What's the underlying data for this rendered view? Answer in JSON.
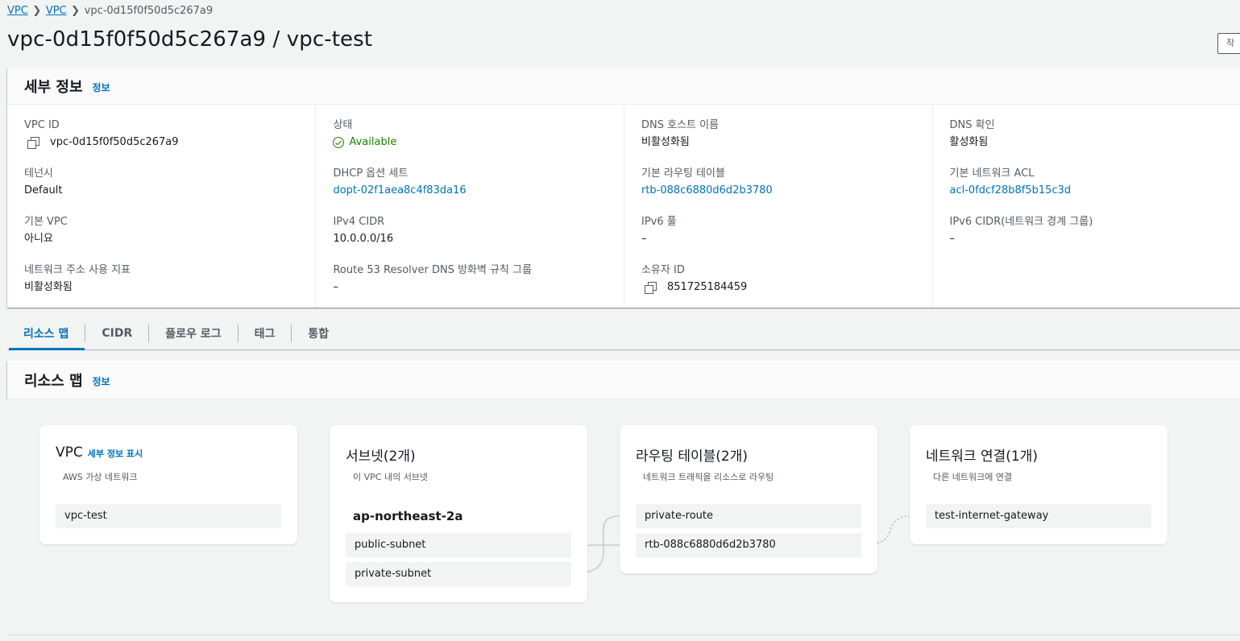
{
  "breadcrumb": {
    "items": [
      "VPC",
      "VPC"
    ],
    "current": "vpc-0d15f0f50d5c267a9"
  },
  "page": {
    "title": "vpc-0d15f0f50d5c267a9 / vpc-test",
    "action_label": "작"
  },
  "details": {
    "title": "세부 정보",
    "info": "정보",
    "columns": [
      [
        {
          "label": "VPC ID",
          "value": "vpc-0d15f0f50d5c267a9"
        },
        {
          "label": "테넌시",
          "value": "Default"
        },
        {
          "label": "기본 VPC",
          "value": "아니요"
        },
        {
          "label": "네트워크 주소 사용 지표",
          "value": "비활성화됨"
        }
      ],
      [
        {
          "label": "상태",
          "value": "Available"
        },
        {
          "label": "DHCP 옵션 세트",
          "value": "dopt-02f1aea8c4f83da16"
        },
        {
          "label": "IPv4 CIDR",
          "value": "10.0.0.0/16"
        },
        {
          "label": "Route 53 Resolver DNS 방화벽 규칙 그룹",
          "value": "–"
        }
      ],
      [
        {
          "label": "DNS 호스트 이름",
          "value": "비활성화됨"
        },
        {
          "label": "기본 라우팅 테이블",
          "value": "rtb-088c6880d6d2b3780"
        },
        {
          "label": "IPv6 풀",
          "value": "–"
        },
        {
          "label": "소유자 ID",
          "value": "851725184459"
        }
      ],
      [
        {
          "label": "DNS 확인",
          "value": "활성화됨"
        },
        {
          "label": "기본 네트워크 ACL",
          "value": "acl-0fdcf28b8f5b15c3d"
        },
        {
          "label": "IPv6 CIDR(네트워크 경계 그룹)",
          "value": "–"
        }
      ]
    ]
  },
  "tabs": [
    "리소스 맵",
    "CIDR",
    "플로우 로그",
    "태그",
    "통합"
  ],
  "resource_map": {
    "title": "리소스 맵",
    "info": "정보",
    "vpc": {
      "title": "VPC",
      "link": "세부 정보 표시",
      "subtitle": "AWS 가상 네트워크",
      "items": [
        "vpc-test"
      ]
    },
    "subnets": {
      "title": "서브넷(2개)",
      "subtitle": "이 VPC 내의 서브넷",
      "az": "ap-northeast-2a",
      "items": [
        "public-subnet",
        "private-subnet"
      ]
    },
    "route_tables": {
      "title": "라우팅 테이블(2개)",
      "subtitle": "네트워크 트래픽을 리소스로 라우팅",
      "items": [
        "private-route",
        "rtb-088c6880d6d2b3780"
      ]
    },
    "connections": {
      "title": "네트워크 연결(1개)",
      "subtitle": "다른 네트워크에 연결",
      "items": [
        "test-internet-gateway"
      ]
    }
  },
  "colors": {
    "link": "#0073bb",
    "success": "#1d8102",
    "text": "#16191f",
    "muted": "#545b64"
  }
}
